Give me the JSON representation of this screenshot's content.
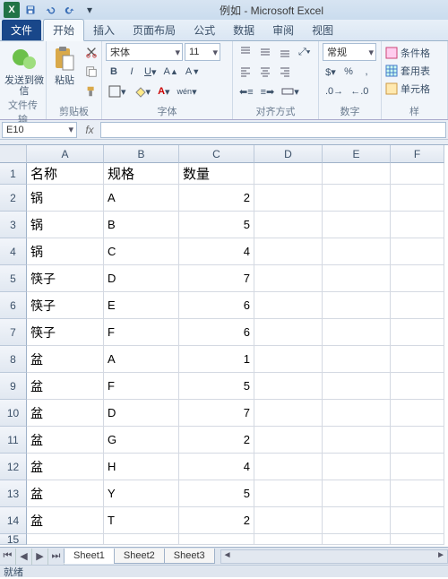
{
  "title": "例如 - Microsoft Excel",
  "qat": {
    "save": "保存",
    "undo": "撤销",
    "redo": "恢复"
  },
  "tabs": {
    "file": "文件",
    "items": [
      "开始",
      "插入",
      "页面布局",
      "公式",
      "数据",
      "审阅",
      "视图"
    ],
    "active": 0
  },
  "ribbon": {
    "wechat": {
      "label": "发送到微信",
      "group": "文件传输"
    },
    "clipboard": {
      "paste": "粘贴",
      "group": "剪贴板"
    },
    "font": {
      "name": "宋体",
      "size": "11",
      "group": "字体"
    },
    "align": {
      "group": "对齐方式"
    },
    "number": {
      "format": "常规",
      "group": "数字"
    },
    "styles": {
      "cond": "条件格",
      "table": "套用表",
      "cell": "单元格",
      "group": "样"
    }
  },
  "namebox": "E10",
  "fx_label": "fx",
  "columns": [
    "A",
    "B",
    "C",
    "D",
    "E",
    "F"
  ],
  "headers": [
    "名称",
    "规格",
    "数量"
  ],
  "data_rows": [
    {
      "n": "锅",
      "s": "A",
      "q": "2"
    },
    {
      "n": "锅",
      "s": "B",
      "q": "5"
    },
    {
      "n": "锅",
      "s": "C",
      "q": "4"
    },
    {
      "n": "筷子",
      "s": "D",
      "q": "7"
    },
    {
      "n": "筷子",
      "s": "E",
      "q": "6"
    },
    {
      "n": "筷子",
      "s": "F",
      "q": "6"
    },
    {
      "n": "盆",
      "s": "A",
      "q": "1"
    },
    {
      "n": "盆",
      "s": "F",
      "q": "5"
    },
    {
      "n": "盆",
      "s": "D",
      "q": "7"
    },
    {
      "n": "盆",
      "s": "G",
      "q": "2"
    },
    {
      "n": "盆",
      "s": "H",
      "q": "4"
    },
    {
      "n": "盆",
      "s": "Y",
      "q": "5"
    },
    {
      "n": "盆",
      "s": "T",
      "q": "2"
    }
  ],
  "sheets": [
    "Sheet1",
    "Sheet2",
    "Sheet3"
  ],
  "status": "就绪"
}
